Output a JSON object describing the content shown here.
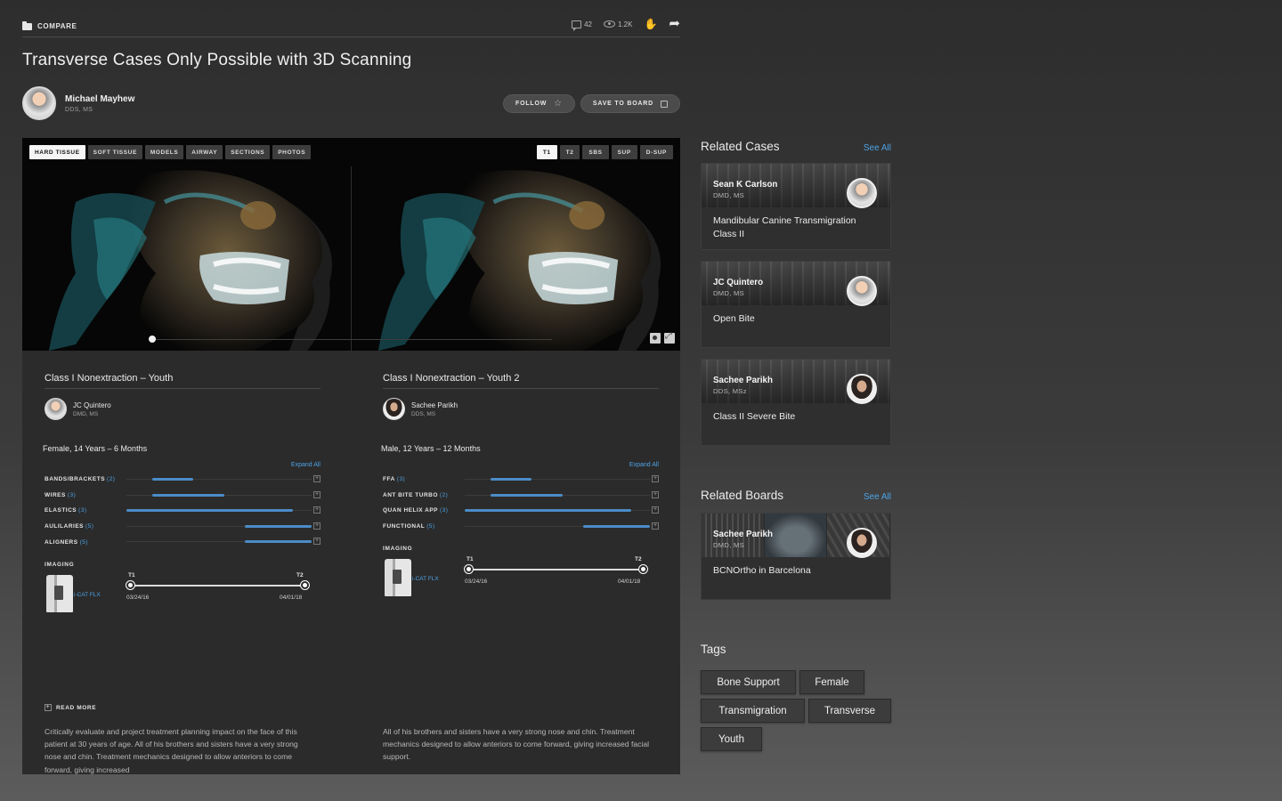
{
  "header": {
    "section_label": "COMPARE",
    "comments_count": "42",
    "views_count": "1.2K",
    "title": "Transverse Cases Only Possible with 3D Scanning",
    "author_name": "Michael Mayhew",
    "author_cred": "DDS, MS",
    "follow_label": "FOLLOW",
    "save_label": "SAVE TO BOARD"
  },
  "viewer": {
    "view_tabs": [
      "HARD TISSUE",
      "SOFT TISSUE",
      "MODELS",
      "AIRWAY",
      "SECTIONS",
      "PHOTOS"
    ],
    "active_view_tab": "HARD TISSUE",
    "time_tabs": [
      "T1",
      "T2",
      "SBS",
      "SUP",
      "D-SUP"
    ],
    "active_time_tab": "T1",
    "scrubber_position": 0.0
  },
  "cases": [
    {
      "title": "Class I Nonextraction – Youth",
      "doctor_name": "JC Quintero",
      "doctor_cred": "DMD, MS",
      "patient": "Female, 14 Years – 6 Months",
      "expand_label": "Expand All",
      "appliances": [
        {
          "label": "BANDS/BRACKETS",
          "count": "(2)",
          "start": 0.14,
          "end": 0.36
        },
        {
          "label": "WIRES",
          "count": "(3)",
          "start": 0.14,
          "end": 0.53
        },
        {
          "label": "ELASTICS",
          "count": "(3)",
          "start": 0.0,
          "end": 0.9
        },
        {
          "label": "AULILARIES",
          "count": "(5)",
          "start": 0.64,
          "end": 1.0
        },
        {
          "label": "ALIGNERS",
          "count": "(5)",
          "start": 0.64,
          "end": 1.0
        }
      ],
      "imaging_label": "IMAGING",
      "device": "i-CAT FLX",
      "t1_label": "T1",
      "t2_label": "T2",
      "t1_date": "03/24/16",
      "t2_date": "04/01/18"
    },
    {
      "title": "Class I Nonextraction – Youth 2",
      "doctor_name": "Sachee Parikh",
      "doctor_cred": "DDS, MS",
      "patient": "Male, 12 Years – 12 Months",
      "expand_label": "Expand All",
      "appliances": [
        {
          "label": "FFA",
          "count": "(3)",
          "start": 0.14,
          "end": 0.36
        },
        {
          "label": "ANT BITE TURBO",
          "count": "(2)",
          "start": 0.14,
          "end": 0.53
        },
        {
          "label": "QUAN HELIX APP",
          "count": "(3)",
          "start": 0.0,
          "end": 0.9
        },
        {
          "label": "FUNCTIONAL",
          "count": "(5)",
          "start": 0.64,
          "end": 1.0
        }
      ],
      "imaging_label": "IMAGING",
      "device": "i-CAT FLX",
      "t1_label": "T1",
      "t2_label": "T2",
      "t1_date": "03/24/16",
      "t2_date": "04/01/18"
    }
  ],
  "read_more_label": "READ MORE",
  "descriptions": [
    "Critically evaluate and project treatment planning impact on the face of this patient at 30 years of age. All of his brothers and sisters have a very strong nose and chin. Treatment mechanics designed to allow anteriors to come forward, giving increased",
    "All of his brothers and sisters have a very strong nose and chin. Treatment mechanics designed to allow anteriors to come forward, giving increased facial support."
  ],
  "related_cases": {
    "heading": "Related Cases",
    "see_all": "See All",
    "items": [
      {
        "name": "Sean K Carlson",
        "cred": "DMD, MS",
        "title": "Mandibular Canine Transmigration Class II"
      },
      {
        "name": "JC Quintero",
        "cred": "DMD, MS",
        "title": "Open Bite"
      },
      {
        "name": "Sachee Parikh",
        "cred": "DDS, MSz",
        "title": "Class II Severe Bite"
      }
    ]
  },
  "related_boards": {
    "heading": "Related Boards",
    "see_all": "See All",
    "items": [
      {
        "name": "Sachee Parikh",
        "cred": "DMD, MS",
        "title": "BCNOrtho in Barcelona"
      }
    ]
  },
  "tags": {
    "heading": "Tags",
    "items": [
      "Bone Support",
      "Female",
      "Transmigration",
      "Transverse",
      "Youth"
    ]
  },
  "colors": {
    "accent": "#4da3e6",
    "bar": "#4b8cc7",
    "panel": "#2b2b2b"
  }
}
